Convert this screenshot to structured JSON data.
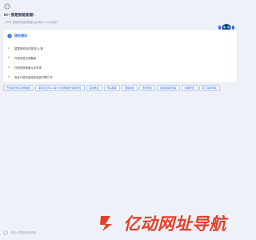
{
  "header": {
    "greeting": "Hi~ 我是智能客服!",
    "subtext": "上午好 我是你的智能助理,请问有什么可以帮您?"
  },
  "faq": {
    "title": "猜你想问",
    "items": [
      {
        "num": "1",
        "text": "重置密码如何登录2上报"
      },
      {
        "num": "2",
        "text": "开税务登记用备案"
      },
      {
        "num": "3",
        "text": "开税务报备备认步须求"
      },
      {
        "num": "4",
        "text": "电多户税务使用的免费开票方式"
      }
    ]
  },
  "tags": [
    "开办首次电子税务报装",
    "填写企业年3人首户户资纳税纸/免用增业",
    "首源电话",
    "申请发票",
    "发票快检",
    "增值查搬",
    "领用发票和发票",
    "申报增值",
    "职工基本申请"
  ],
  "logo": {
    "text": "亿动网址导航"
  },
  "input": {
    "placeholder": "请输入您要咨询的问题"
  },
  "colors": {
    "accent": "#2f6be8",
    "logo": "#e4402c",
    "background": "#eef2f8"
  }
}
